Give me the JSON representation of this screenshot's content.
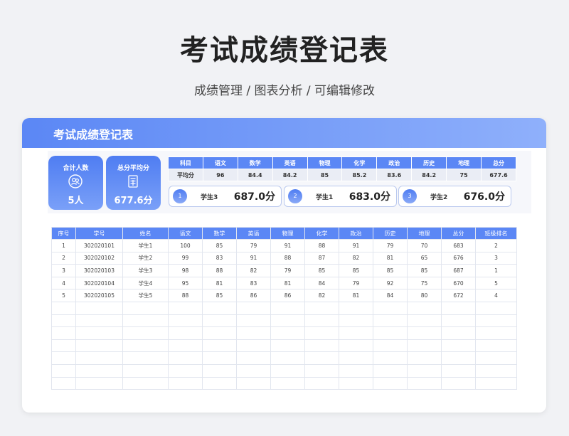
{
  "page": {
    "title": "考试成绩登记表",
    "subtitle": "成绩管理 / 图表分析 / 可编辑修改"
  },
  "card": {
    "header": "考试成绩登记表"
  },
  "stats": [
    {
      "label": "合计人数",
      "value": "5人",
      "icon": "users-icon"
    },
    {
      "label": "总分平均分",
      "value": "677.6分",
      "icon": "calculator-icon"
    }
  ],
  "averages": {
    "headers": [
      "科目",
      "语文",
      "数学",
      "英语",
      "物理",
      "化学",
      "政治",
      "历史",
      "地理",
      "总分"
    ],
    "row": [
      "平均分",
      "96",
      "84.4",
      "84.2",
      "85",
      "85.2",
      "83.6",
      "84.2",
      "75",
      "677.6"
    ]
  },
  "top3": [
    {
      "rank": "1",
      "name": "学生3",
      "score": "687.0分"
    },
    {
      "rank": "2",
      "name": "学生1",
      "score": "683.0分"
    },
    {
      "rank": "3",
      "name": "学生2",
      "score": "676.0分"
    }
  ],
  "table": {
    "headers": [
      "序号",
      "学号",
      "姓名",
      "语文",
      "数学",
      "英语",
      "物理",
      "化学",
      "政治",
      "历史",
      "地理",
      "总分",
      "班级排名"
    ],
    "rows": [
      [
        "1",
        "302020101",
        "学生1",
        "100",
        "85",
        "79",
        "91",
        "88",
        "91",
        "79",
        "70",
        "683",
        "2"
      ],
      [
        "2",
        "302020102",
        "学生2",
        "99",
        "83",
        "91",
        "88",
        "87",
        "82",
        "81",
        "65",
        "676",
        "3"
      ],
      [
        "3",
        "302020103",
        "学生3",
        "98",
        "88",
        "82",
        "79",
        "85",
        "85",
        "85",
        "85",
        "687",
        "1"
      ],
      [
        "4",
        "302020104",
        "学生4",
        "95",
        "81",
        "83",
        "81",
        "84",
        "79",
        "92",
        "75",
        "670",
        "5"
      ],
      [
        "5",
        "302020105",
        "学生5",
        "88",
        "85",
        "86",
        "86",
        "82",
        "81",
        "84",
        "80",
        "672",
        "4"
      ]
    ],
    "empty_rows": 7
  },
  "colors": {
    "accent": "#5b87f5",
    "accent_light": "#8fb0fb"
  }
}
